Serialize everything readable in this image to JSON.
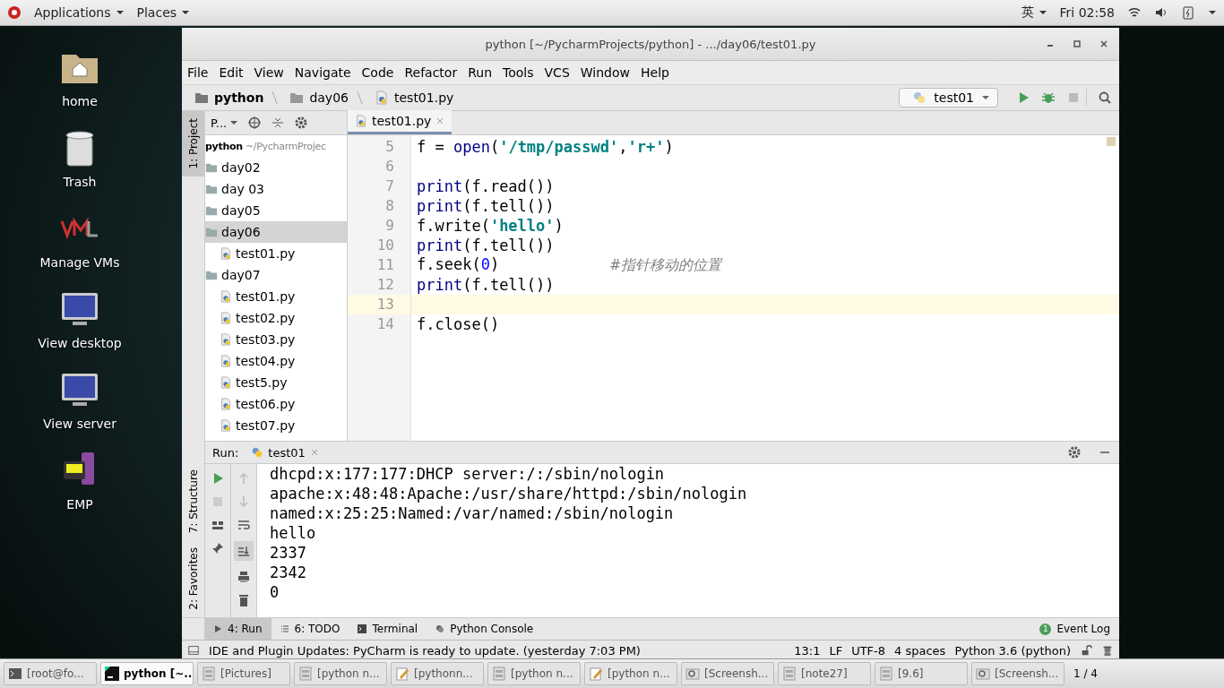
{
  "top_bar": {
    "applications": "Applications",
    "places": "Places",
    "input_method": "英",
    "clock": "Fri 02:58"
  },
  "desktop_icons": [
    {
      "label": "home",
      "kind": "folder"
    },
    {
      "label": "Trash",
      "kind": "trash"
    },
    {
      "label": "Manage VMs",
      "kind": "vm"
    },
    {
      "label": "View desktop",
      "kind": "monitor"
    },
    {
      "label": "View server",
      "kind": "monitor"
    },
    {
      "label": "EMP",
      "kind": "device"
    }
  ],
  "window": {
    "title": "python [~/PycharmProjects/python] - .../day06/test01.py"
  },
  "menu": [
    "File",
    "Edit",
    "View",
    "Navigate",
    "Code",
    "Refactor",
    "Run",
    "Tools",
    "VCS",
    "Window",
    "Help"
  ],
  "breadcrumbs": [
    {
      "label": "python",
      "kind": "project"
    },
    {
      "label": "day06",
      "kind": "folder"
    },
    {
      "label": "test01.py",
      "kind": "file"
    }
  ],
  "run_config": "test01",
  "tool_stripe": [
    {
      "label": "1: Project",
      "selected": true
    },
    {
      "label": "7: Structure",
      "selected": false
    },
    {
      "label": "2: Favorites",
      "selected": false
    }
  ],
  "project_panel": {
    "view": "P...",
    "root": {
      "label": "python",
      "path": "~/PycharmProjec"
    },
    "tree": [
      {
        "label": "day02",
        "kind": "folder",
        "selected": false
      },
      {
        "label": "day 03",
        "kind": "folder",
        "selected": false
      },
      {
        "label": "day05",
        "kind": "folder",
        "selected": false
      },
      {
        "label": "day06",
        "kind": "folder",
        "selected": true,
        "children": [
          {
            "label": "test01.py",
            "kind": "file",
            "selected": false
          }
        ]
      },
      {
        "label": "day07",
        "kind": "folder",
        "selected": false,
        "children": [
          {
            "label": "test01.py",
            "kind": "file",
            "selected": false
          },
          {
            "label": "test02.py",
            "kind": "file",
            "selected": false
          },
          {
            "label": "test03.py",
            "kind": "file",
            "selected": false
          },
          {
            "label": "test04.py",
            "kind": "file",
            "selected": false
          },
          {
            "label": "test5.py",
            "kind": "file",
            "selected": false
          },
          {
            "label": "test06.py",
            "kind": "file",
            "selected": false
          },
          {
            "label": "test07.py",
            "kind": "file",
            "selected": false
          }
        ]
      }
    ]
  },
  "editor": {
    "tabs": [
      {
        "label": "test01.py",
        "selected": true
      }
    ],
    "lines": [
      {
        "number": "5",
        "current": false,
        "tokens": [
          {
            "kind": "plain",
            "text": "f = "
          },
          {
            "kind": "builtin",
            "text": "open"
          },
          {
            "kind": "plain",
            "text": "("
          },
          {
            "kind": "string",
            "text": "'/tmp/passwd'"
          },
          {
            "kind": "plain",
            "text": ","
          },
          {
            "kind": "string",
            "text": "'r+'"
          },
          {
            "kind": "plain",
            "text": ")"
          }
        ]
      },
      {
        "number": "6",
        "current": false
      },
      {
        "number": "7",
        "current": false,
        "tokens": [
          {
            "kind": "builtin",
            "text": "print"
          },
          {
            "kind": "plain",
            "text": "(f.read())"
          }
        ]
      },
      {
        "number": "8",
        "current": false,
        "tokens": [
          {
            "kind": "builtin",
            "text": "print"
          },
          {
            "kind": "plain",
            "text": "(f.tell())"
          }
        ]
      },
      {
        "number": "9",
        "current": false,
        "tokens": [
          {
            "kind": "plain",
            "text": "f.write("
          },
          {
            "kind": "string",
            "text": "'hello'"
          },
          {
            "kind": "plain",
            "text": ")"
          }
        ]
      },
      {
        "number": "10",
        "current": false,
        "tokens": [
          {
            "kind": "builtin",
            "text": "print"
          },
          {
            "kind": "plain",
            "text": "(f.tell())"
          }
        ]
      },
      {
        "number": "11",
        "current": false,
        "tokens": [
          {
            "kind": "plain",
            "text": "f.seek("
          },
          {
            "kind": "number",
            "text": "0"
          },
          {
            "kind": "plain",
            "text": ")            "
          },
          {
            "kind": "comment",
            "text": "#指针移动的位置"
          }
        ]
      },
      {
        "number": "12",
        "current": false,
        "tokens": [
          {
            "kind": "builtin",
            "text": "print"
          },
          {
            "kind": "plain",
            "text": "(f.tell())"
          }
        ]
      },
      {
        "number": "13",
        "current": true
      },
      {
        "number": "14",
        "current": false,
        "tokens": [
          {
            "kind": "plain",
            "text": "f.close()"
          }
        ]
      }
    ]
  },
  "run_panel": {
    "label": "Run:",
    "tab": "test01",
    "output": [
      "dhcpd:x:177:177:DHCP server:/:/sbin/nologin",
      "apache:x:48:48:Apache:/usr/share/httpd:/sbin/nologin",
      "named:x:25:25:Named:/var/named:/sbin/nologin",
      "hello",
      "2337",
      "2342",
      "0"
    ]
  },
  "bottom_tabs": [
    {
      "label": "4: Run",
      "kind": "run",
      "selected": true
    },
    {
      "label": "6: TODO",
      "kind": "todo",
      "selected": false
    },
    {
      "label": "Terminal",
      "kind": "terminal",
      "selected": false
    },
    {
      "label": "Python Console",
      "kind": "console",
      "selected": false
    }
  ],
  "event_log": {
    "label": "Event Log",
    "count": "1"
  },
  "status_bar": {
    "message": "IDE and Plugin Updates: PyCharm is ready to update. (yesterday 7:03 PM)",
    "items": [
      "13:1",
      "LF",
      "UTF-8",
      "4 spaces",
      "Python 3.6 (python)"
    ]
  },
  "taskbar": [
    {
      "label": "[root@fo...",
      "kind": "terminal",
      "selected": false
    },
    {
      "label": "python [~...",
      "kind": "pycharm",
      "selected": true
    },
    {
      "label": "[Pictures]",
      "kind": "files",
      "selected": false
    },
    {
      "label": "[python n...",
      "kind": "files",
      "selected": false
    },
    {
      "label": "[pythonn...",
      "kind": "editor",
      "selected": false
    },
    {
      "label": "[python n...",
      "kind": "files",
      "selected": false
    },
    {
      "label": "[python n...",
      "kind": "editor",
      "selected": false
    },
    {
      "label": "[Screensh...",
      "kind": "screenshot",
      "selected": false
    },
    {
      "label": "[note27]",
      "kind": "files",
      "selected": false
    },
    {
      "label": "[9.6]",
      "kind": "files",
      "selected": false
    },
    {
      "label": "[Screensh...",
      "kind": "screenshot",
      "selected": false
    }
  ],
  "workspace": "1 / 4"
}
